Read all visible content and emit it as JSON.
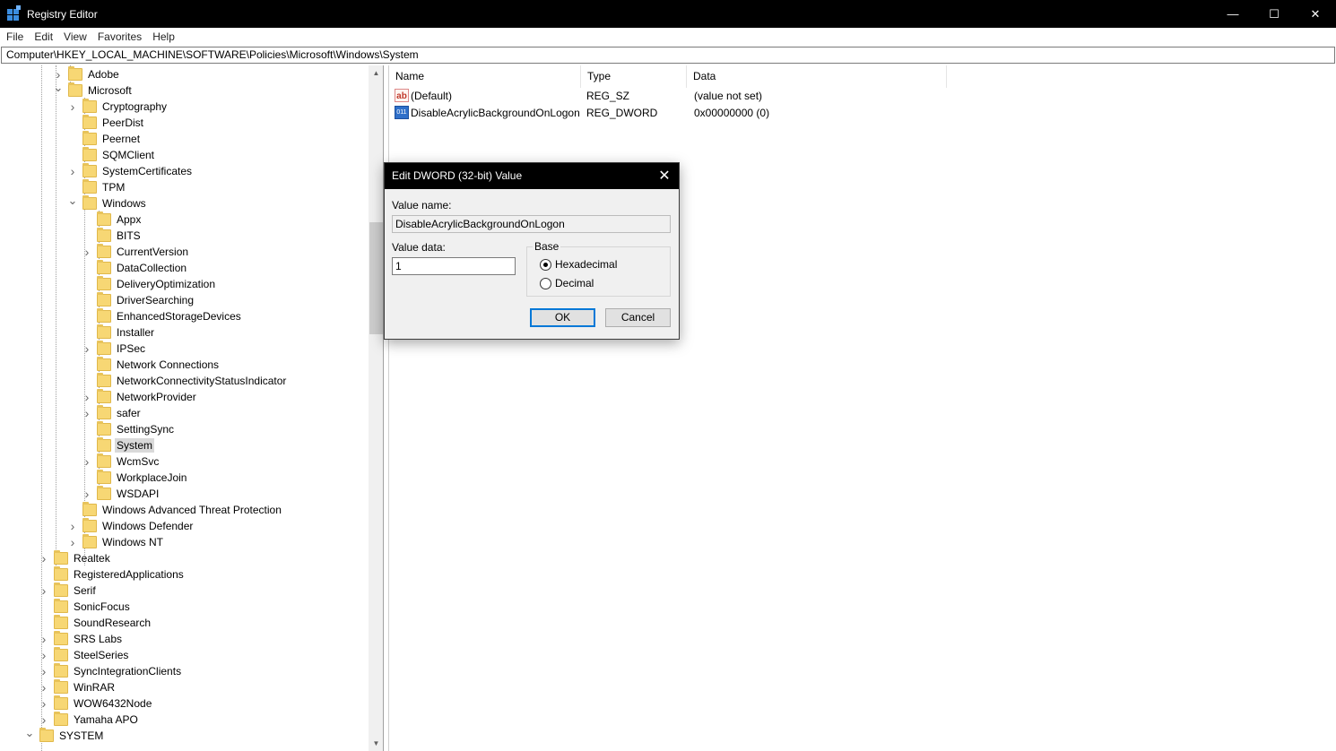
{
  "window": {
    "title": "Registry Editor",
    "minimize": "—",
    "maximize": "☐",
    "close": "✕"
  },
  "menu": [
    "File",
    "Edit",
    "View",
    "Favorites",
    "Help"
  ],
  "address": "Computer\\HKEY_LOCAL_MACHINE\\SOFTWARE\\Policies\\Microsoft\\Windows\\System",
  "tree": [
    {
      "label": "Adobe",
      "level": 2,
      "chevron": "right"
    },
    {
      "label": "Microsoft",
      "level": 2,
      "chevron": "down"
    },
    {
      "label": "Cryptography",
      "level": 3,
      "chevron": "right"
    },
    {
      "label": "PeerDist",
      "level": 3,
      "chevron": ""
    },
    {
      "label": "Peernet",
      "level": 3,
      "chevron": ""
    },
    {
      "label": "SQMClient",
      "level": 3,
      "chevron": ""
    },
    {
      "label": "SystemCertificates",
      "level": 3,
      "chevron": "right"
    },
    {
      "label": "TPM",
      "level": 3,
      "chevron": ""
    },
    {
      "label": "Windows",
      "level": 3,
      "chevron": "down"
    },
    {
      "label": "Appx",
      "level": 4,
      "chevron": ""
    },
    {
      "label": "BITS",
      "level": 4,
      "chevron": ""
    },
    {
      "label": "CurrentVersion",
      "level": 4,
      "chevron": "right"
    },
    {
      "label": "DataCollection",
      "level": 4,
      "chevron": ""
    },
    {
      "label": "DeliveryOptimization",
      "level": 4,
      "chevron": ""
    },
    {
      "label": "DriverSearching",
      "level": 4,
      "chevron": ""
    },
    {
      "label": "EnhancedStorageDevices",
      "level": 4,
      "chevron": ""
    },
    {
      "label": "Installer",
      "level": 4,
      "chevron": ""
    },
    {
      "label": "IPSec",
      "level": 4,
      "chevron": "right"
    },
    {
      "label": "Network Connections",
      "level": 4,
      "chevron": ""
    },
    {
      "label": "NetworkConnectivityStatusIndicator",
      "level": 4,
      "chevron": ""
    },
    {
      "label": "NetworkProvider",
      "level": 4,
      "chevron": "right"
    },
    {
      "label": "safer",
      "level": 4,
      "chevron": "right"
    },
    {
      "label": "SettingSync",
      "level": 4,
      "chevron": ""
    },
    {
      "label": "System",
      "level": 4,
      "chevron": "",
      "selected": true
    },
    {
      "label": "WcmSvc",
      "level": 4,
      "chevron": "right"
    },
    {
      "label": "WorkplaceJoin",
      "level": 4,
      "chevron": ""
    },
    {
      "label": "WSDAPI",
      "level": 4,
      "chevron": "right"
    },
    {
      "label": "Windows Advanced Threat Protection",
      "level": 3,
      "chevron": ""
    },
    {
      "label": "Windows Defender",
      "level": 3,
      "chevron": "right"
    },
    {
      "label": "Windows NT",
      "level": 3,
      "chevron": "right"
    },
    {
      "label": "Realtek",
      "level": 1,
      "chevron": "right"
    },
    {
      "label": "RegisteredApplications",
      "level": 1,
      "chevron": ""
    },
    {
      "label": "Serif",
      "level": 1,
      "chevron": "right"
    },
    {
      "label": "SonicFocus",
      "level": 1,
      "chevron": ""
    },
    {
      "label": "SoundResearch",
      "level": 1,
      "chevron": ""
    },
    {
      "label": "SRS Labs",
      "level": 1,
      "chevron": "right"
    },
    {
      "label": "SteelSeries",
      "level": 1,
      "chevron": "right"
    },
    {
      "label": "SyncIntegrationClients",
      "level": 1,
      "chevron": "right"
    },
    {
      "label": "WinRAR",
      "level": 1,
      "chevron": "right"
    },
    {
      "label": "WOW6432Node",
      "level": 1,
      "chevron": "right"
    },
    {
      "label": "Yamaha APO",
      "level": 1,
      "chevron": "right"
    },
    {
      "label": "SYSTEM",
      "level": 0,
      "chevron": "down"
    }
  ],
  "list": {
    "columns": [
      "Name",
      "Type",
      "Data"
    ],
    "rows": [
      {
        "icon": "string-value-icon",
        "icon_text": "ab",
        "name": "(Default)",
        "type": "REG_SZ",
        "data": "(value not set)"
      },
      {
        "icon": "binary-value-icon",
        "icon_text": "011",
        "name": "DisableAcrylicBackgroundOnLogon",
        "type": "REG_DWORD",
        "data": "0x00000000 (0)"
      }
    ]
  },
  "dialog": {
    "title": "Edit DWORD (32-bit) Value",
    "value_name_label": "Value name:",
    "value_name": "DisableAcrylicBackgroundOnLogon",
    "value_data_label": "Value data:",
    "value_data": "1",
    "base_label": "Base",
    "hex_label": "Hexadecimal",
    "dec_label": "Decimal",
    "selected_base": "Hexadecimal",
    "ok_label": "OK",
    "cancel_label": "Cancel"
  }
}
